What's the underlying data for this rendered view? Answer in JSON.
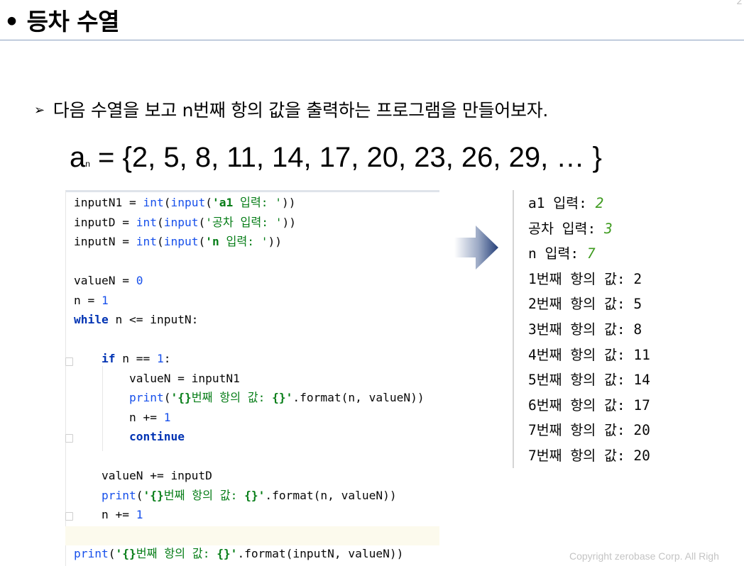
{
  "slide": {
    "title": "• 등차 수열",
    "bullet_arrow": "➢",
    "bullet_text": "다음 수열을 보고 n번째 항의 값을 출력하는 프로그램을 만들어보자.",
    "formula_base": "a",
    "formula_sub": "n",
    "formula_rest": " = {2, 5, 8, 11, 14, 17, 20, 23, 26, 29, … }",
    "corner_mark": "2",
    "copyright": "Copyright zerobase Corp. All Righ"
  },
  "editor": {
    "lines": [
      {
        "id": "l1",
        "segments": [
          {
            "t": "inputN1 = ",
            "c": "plain"
          },
          {
            "t": "int",
            "c": "fn"
          },
          {
            "t": "(",
            "c": "plain"
          },
          {
            "t": "input",
            "c": "fn"
          },
          {
            "t": "(",
            "c": "plain"
          },
          {
            "t": "'a1",
            "c": "strb"
          },
          {
            "t": " 입력: '",
            "c": "str"
          },
          {
            "t": "))",
            "c": "plain"
          }
        ]
      },
      {
        "id": "l2",
        "segments": [
          {
            "t": "inputD = ",
            "c": "plain"
          },
          {
            "t": "int",
            "c": "fn"
          },
          {
            "t": "(",
            "c": "plain"
          },
          {
            "t": "input",
            "c": "fn"
          },
          {
            "t": "(",
            "c": "plain"
          },
          {
            "t": "'공차 입력: '",
            "c": "str"
          },
          {
            "t": "))",
            "c": "plain"
          }
        ]
      },
      {
        "id": "l3",
        "segments": [
          {
            "t": "inputN = ",
            "c": "plain"
          },
          {
            "t": "int",
            "c": "fn"
          },
          {
            "t": "(",
            "c": "plain"
          },
          {
            "t": "input",
            "c": "fn"
          },
          {
            "t": "(",
            "c": "plain"
          },
          {
            "t": "'n",
            "c": "strb"
          },
          {
            "t": " 입력: '",
            "c": "str"
          },
          {
            "t": "))",
            "c": "plain"
          }
        ]
      },
      {
        "id": "l4",
        "segments": []
      },
      {
        "id": "l5",
        "segments": [
          {
            "t": "valueN = ",
            "c": "plain"
          },
          {
            "t": "0",
            "c": "num"
          }
        ]
      },
      {
        "id": "l6",
        "segments": [
          {
            "t": "n = ",
            "c": "plain"
          },
          {
            "t": "1",
            "c": "num"
          }
        ]
      },
      {
        "id": "l7",
        "segments": [
          {
            "t": "while",
            "c": "kw"
          },
          {
            "t": " n <= inputN:",
            "c": "plain"
          }
        ]
      },
      {
        "id": "l8",
        "segments": []
      },
      {
        "id": "l9",
        "segments": [
          {
            "t": "    ",
            "c": "plain"
          },
          {
            "t": "if",
            "c": "kw"
          },
          {
            "t": " n == ",
            "c": "plain"
          },
          {
            "t": "1",
            "c": "num"
          },
          {
            "t": ":",
            "c": "plain"
          }
        ]
      },
      {
        "id": "l10",
        "segments": [
          {
            "t": "        valueN = inputN1",
            "c": "plain"
          }
        ]
      },
      {
        "id": "l11",
        "segments": [
          {
            "t": "        ",
            "c": "plain"
          },
          {
            "t": "print",
            "c": "fn"
          },
          {
            "t": "(",
            "c": "plain"
          },
          {
            "t": "'{}",
            "c": "strb"
          },
          {
            "t": "번째 항의 값: ",
            "c": "str"
          },
          {
            "t": "{}'",
            "c": "strb"
          },
          {
            "t": ".format(n, valueN))",
            "c": "plain"
          }
        ]
      },
      {
        "id": "l12",
        "segments": [
          {
            "t": "        n += ",
            "c": "plain"
          },
          {
            "t": "1",
            "c": "num"
          }
        ]
      },
      {
        "id": "l13",
        "segments": [
          {
            "t": "        ",
            "c": "plain"
          },
          {
            "t": "continue",
            "c": "kw"
          }
        ]
      },
      {
        "id": "l14",
        "segments": []
      },
      {
        "id": "l15",
        "segments": [
          {
            "t": "    valueN += inputD",
            "c": "plain"
          }
        ]
      },
      {
        "id": "l16",
        "segments": [
          {
            "t": "    ",
            "c": "plain"
          },
          {
            "t": "print",
            "c": "fn"
          },
          {
            "t": "(",
            "c": "plain"
          },
          {
            "t": "'{}",
            "c": "strb"
          },
          {
            "t": "번째 항의 값: ",
            "c": "str"
          },
          {
            "t": "{}'",
            "c": "strb"
          },
          {
            "t": ".format(n, valueN))",
            "c": "plain"
          }
        ]
      },
      {
        "id": "l17",
        "segments": [
          {
            "t": "    n += ",
            "c": "plain"
          },
          {
            "t": "1",
            "c": "num"
          }
        ]
      },
      {
        "id": "l18",
        "segments": []
      },
      {
        "id": "l19",
        "segments": [
          {
            "t": "print",
            "c": "fn"
          },
          {
            "t": "(",
            "c": "plain"
          },
          {
            "t": "'{}",
            "c": "strb"
          },
          {
            "t": "번째 항의 값: ",
            "c": "str"
          },
          {
            "t": "{}'",
            "c": "strb"
          },
          {
            "t": ".format(inputN, valueN))",
            "c": "plain"
          }
        ]
      }
    ]
  },
  "console": {
    "lines": [
      {
        "prompt": "a1 입력: ",
        "input": "2"
      },
      {
        "prompt": "공차 입력: ",
        "input": "3"
      },
      {
        "prompt": "n 입력: ",
        "input": "7"
      },
      {
        "prompt": "1번째 항의 값: 2",
        "input": ""
      },
      {
        "prompt": "2번째 항의 값: 5",
        "input": ""
      },
      {
        "prompt": "3번째 항의 값: 8",
        "input": ""
      },
      {
        "prompt": "4번째 항의 값: 11",
        "input": ""
      },
      {
        "prompt": "5번째 항의 값: 14",
        "input": ""
      },
      {
        "prompt": "6번째 항의 값: 17",
        "input": ""
      },
      {
        "prompt": "7번째 항의 값: 20",
        "input": ""
      },
      {
        "prompt": "7번째 항의 값: 20",
        "input": ""
      }
    ]
  },
  "icons": {
    "arrow": "right-arrow-icon"
  }
}
